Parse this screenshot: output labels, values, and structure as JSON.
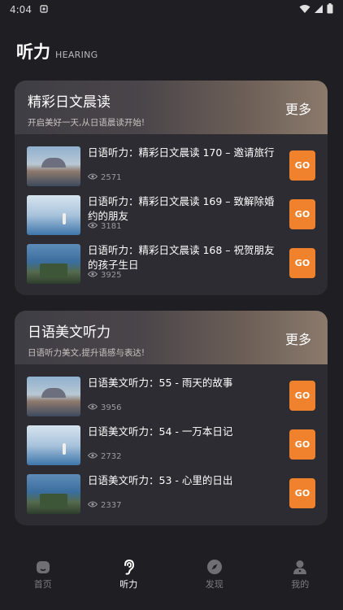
{
  "status_bar": {
    "time": "4:04"
  },
  "header": {
    "title": "听力",
    "subtitle": "HEARING"
  },
  "sections": [
    {
      "title": "精彩日文晨读",
      "description": "开启美好一天,从日语晨读开始!",
      "more_label": "更多",
      "items": [
        {
          "title": "日语听力：精彩日文晨读 170 – 邀请旅行",
          "views": "2571",
          "go_label": "GO",
          "thumb": "city"
        },
        {
          "title": "日语听力：精彩日文晨读 169 – 致解除婚约的朋友",
          "views": "3181",
          "go_label": "GO",
          "thumb": "beach"
        },
        {
          "title": "日语听力：精彩日文晨读 168 – 祝贺朋友的孩子生日",
          "views": "3925",
          "go_label": "GO",
          "thumb": "tram"
        }
      ]
    },
    {
      "title": "日语美文听力",
      "description": "日语听力美文,提升语感与表达!",
      "more_label": "更多",
      "items": [
        {
          "title": "日语美文听力：55 - 雨天的故事",
          "views": "3956",
          "go_label": "GO",
          "thumb": "city"
        },
        {
          "title": "日语美文听力：54 - 一万本日记",
          "views": "2732",
          "go_label": "GO",
          "thumb": "beach"
        },
        {
          "title": "日语美文听力：53 - 心里的日出",
          "views": "2337",
          "go_label": "GO",
          "thumb": "tram"
        }
      ]
    }
  ],
  "tabs": [
    {
      "label": "首页",
      "icon": "home-icon",
      "active": false
    },
    {
      "label": "听力",
      "icon": "ear-icon",
      "active": true
    },
    {
      "label": "发现",
      "icon": "compass-icon",
      "active": false
    },
    {
      "label": "我的",
      "icon": "user-icon",
      "active": false
    }
  ],
  "colors": {
    "background": "#1f1e23",
    "card": "#2d2c32",
    "accent": "#f0822d"
  }
}
